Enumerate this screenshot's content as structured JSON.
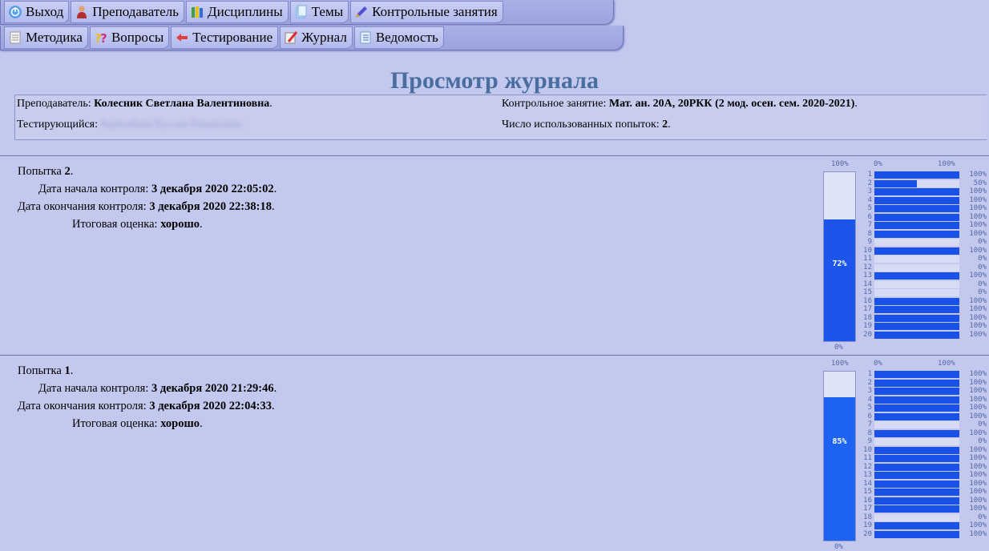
{
  "nav": {
    "row1": [
      {
        "label": "Выход",
        "icon": "power-icon"
      },
      {
        "label": "Преподаватель",
        "icon": "teacher-icon"
      },
      {
        "label": "Дисциплины",
        "icon": "books-icon"
      },
      {
        "label": "Темы",
        "icon": "pages-icon"
      },
      {
        "label": "Контрольные занятия",
        "icon": "pen-icon"
      }
    ],
    "row2": [
      {
        "label": "Методика",
        "icon": "document-icon"
      },
      {
        "label": "Вопросы",
        "icon": "question-icon"
      },
      {
        "label": "Тестирование",
        "icon": "arrow-icon"
      },
      {
        "label": "Журнал",
        "icon": "journal-icon"
      },
      {
        "label": "Ведомость",
        "icon": "list-icon"
      }
    ]
  },
  "page_title": "Просмотр журнала",
  "info": {
    "teacher_label": "Преподаватель: ",
    "teacher_name": "Колесник Светлана Валентиновна",
    "tester_label": "Тестирующийся: ",
    "tester_name": "Картыбаев Руслан Ринатович",
    "control_label": "Контрольное занятие: ",
    "control_value": "Мат. ан. 20А, 20РКК (2 мод. осен. сем. 2020-2021)",
    "attempts_label": "Число использованных попыток: ",
    "attempts_value": "2"
  },
  "labels": {
    "attempt": "Попытка ",
    "start": "Дата начала контроля: ",
    "end": "Дата окончания контроля: ",
    "grade": "Итоговая оценка: "
  },
  "attempts": [
    {
      "number": "2",
      "start": "3 декабря 2020 22:05:02",
      "end": "3 декабря 2020 22:38:18",
      "grade": "хорошо",
      "total": 72,
      "questions": [
        100,
        50,
        100,
        100,
        100,
        100,
        100,
        100,
        0,
        100,
        0,
        0,
        100,
        0,
        0,
        100,
        100,
        100,
        100,
        100
      ]
    },
    {
      "number": "1",
      "start": "3 декабря 2020 21:29:46",
      "end": "3 декабря 2020 22:04:33",
      "grade": "хорошо",
      "total": 85,
      "questions": [
        100,
        100,
        100,
        100,
        100,
        100,
        0,
        100,
        0,
        100,
        100,
        100,
        100,
        100,
        100,
        100,
        100,
        0,
        100,
        100
      ]
    }
  ],
  "chart_labels": {
    "top": "100%",
    "bottom": "0%",
    "q_left": "0%",
    "q_right": "100%"
  },
  "colors": {
    "background": "#c3c9ee",
    "bar": "#1a52e8",
    "title": "#4a6da0"
  }
}
